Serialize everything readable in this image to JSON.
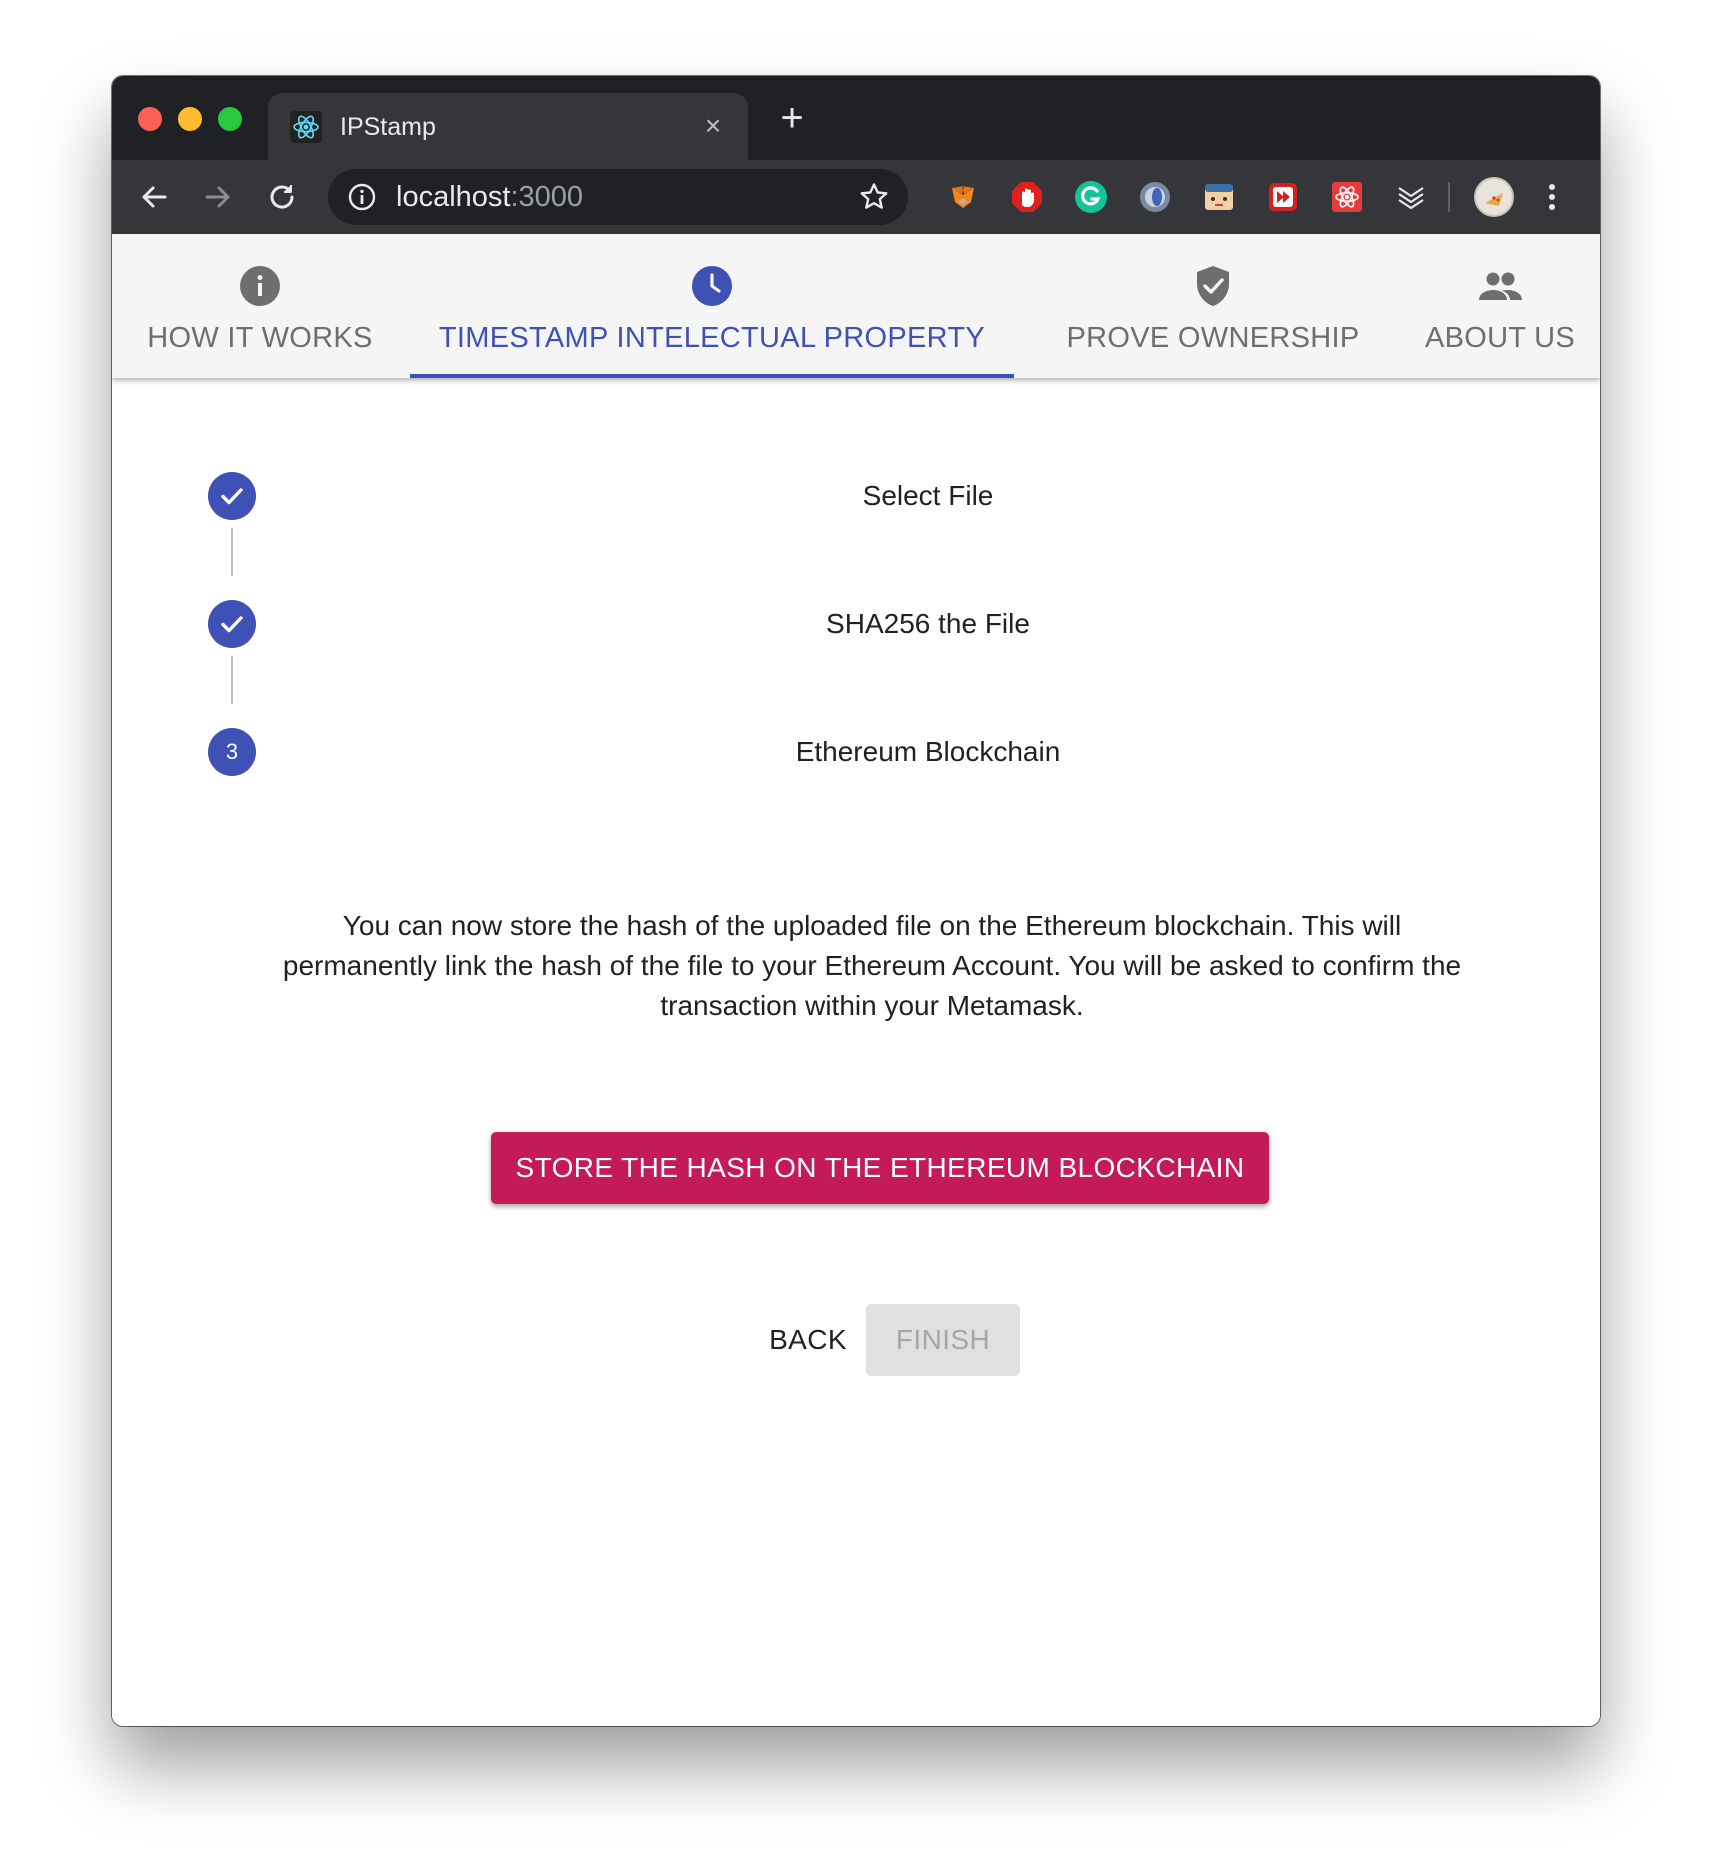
{
  "browser": {
    "tab_title": "IPStamp",
    "tab_close": "×",
    "new_tab": "+",
    "url_host": "localhost",
    "url_port": ":3000",
    "extensions": [
      "metamask-icon",
      "adblock-icon",
      "grammarly-icon",
      "extension-blue-icon",
      "extension-face-icon",
      "extension-red-play-icon",
      "react-devtools-icon",
      "layers-icon"
    ]
  },
  "app_tabs": [
    {
      "label": "HOW IT WORKS",
      "icon": "info-icon",
      "active": false
    },
    {
      "label": "TIMESTAMP INTELECTUAL PROPERTY",
      "icon": "clock-icon",
      "active": true
    },
    {
      "label": "PROVE OWNERSHIP",
      "icon": "shield-check-icon",
      "active": false
    },
    {
      "label": "ABOUT US",
      "icon": "people-icon",
      "active": false
    }
  ],
  "stepper": {
    "steps": [
      {
        "label": "Select File",
        "status": "completed"
      },
      {
        "label": "SHA256 the File",
        "status": "completed"
      },
      {
        "label": "Ethereum Blockchain",
        "status": "active",
        "number": "3"
      }
    ]
  },
  "content": {
    "description": "You can now store the hash of the uploaded file on the Ethereum blockchain. This will permanently link the hash of the file to your Ethereum Account. You will be asked to confirm the transaction within your Metamask.",
    "store_button": "STORE THE HASH ON THE ETHEREUM BLOCKCHAIN",
    "back_button": "BACK",
    "finish_button": "FINISH"
  },
  "colors": {
    "primary": "#3f51b5",
    "secondary": "#c51a5a",
    "disabled_bg": "#e0e0e0",
    "disabled_text": "#a6a6a6"
  }
}
